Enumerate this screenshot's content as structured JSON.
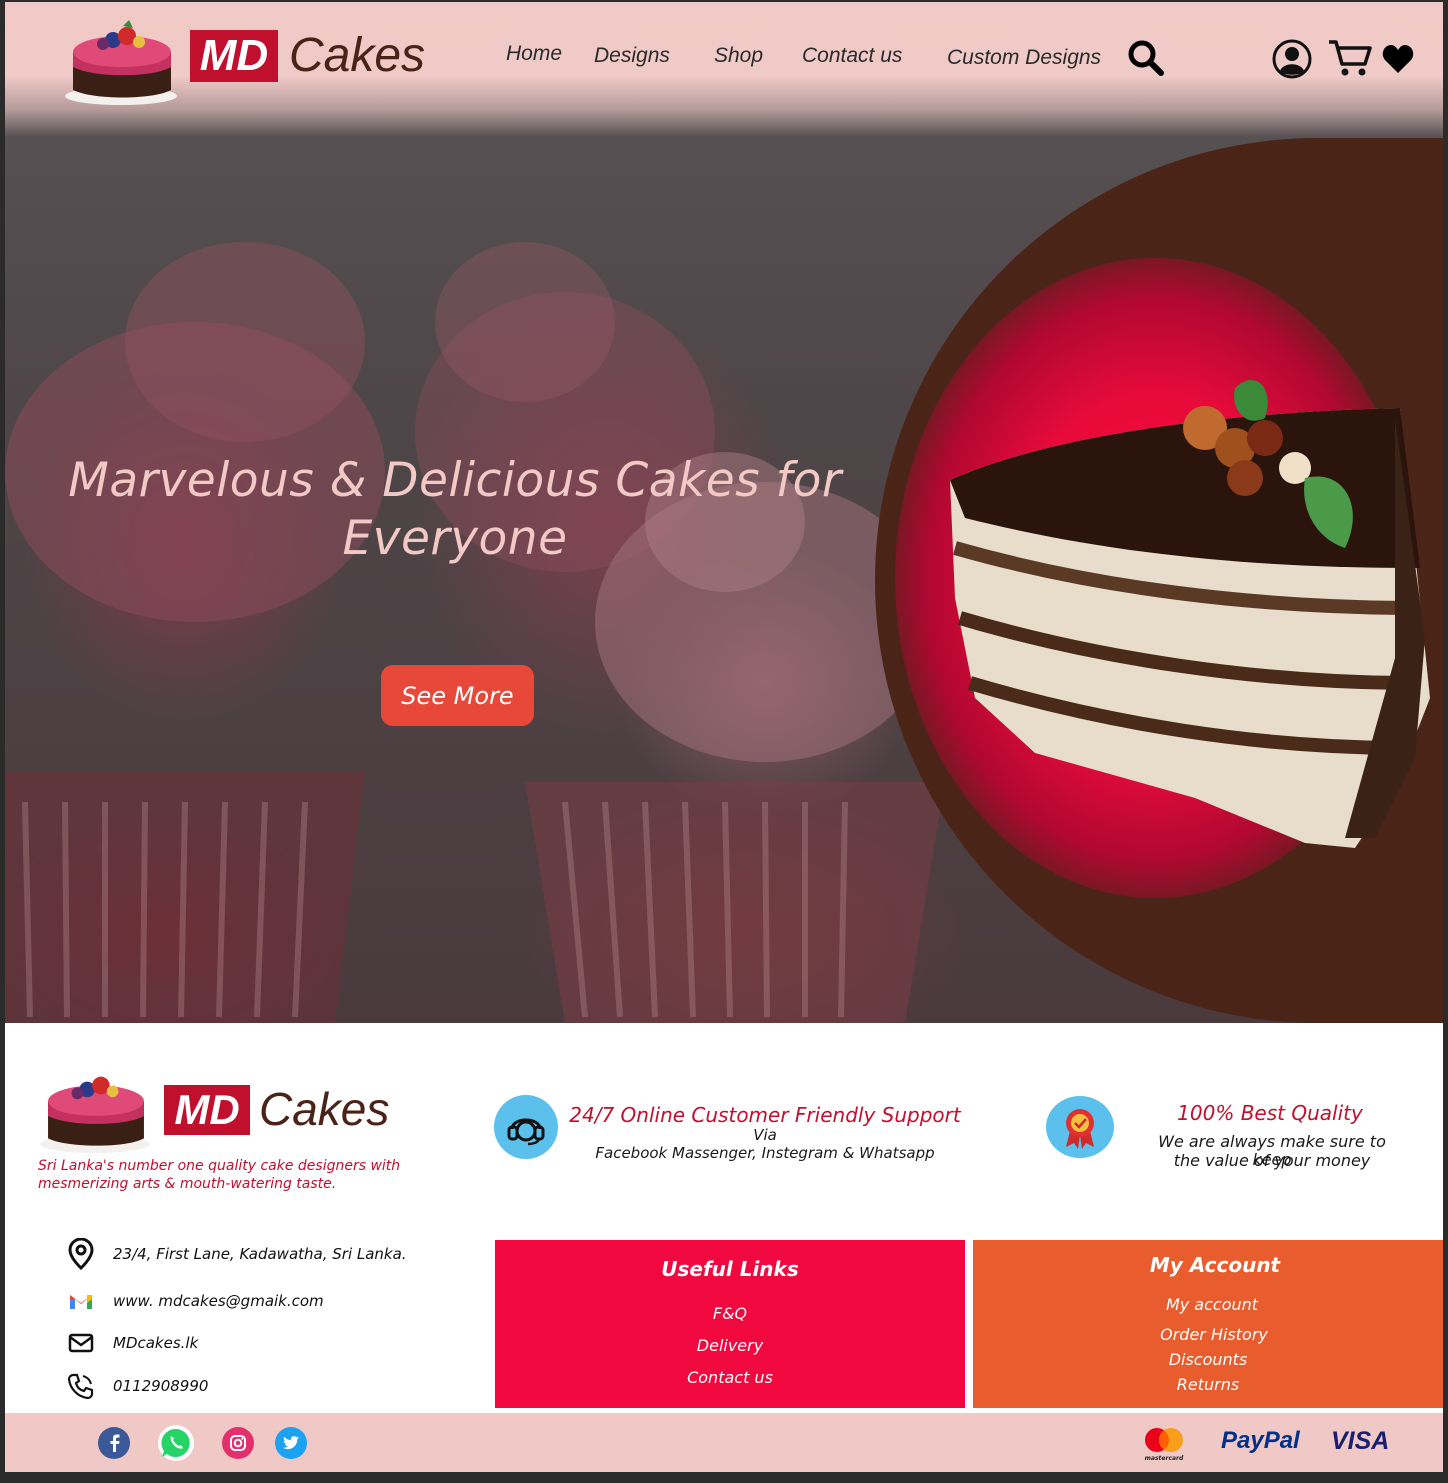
{
  "brand": {
    "md": "MD",
    "cakes": "Cakes"
  },
  "nav": [
    "Home",
    "Designs",
    "Shop",
    "Contact us",
    "Custom Designs"
  ],
  "header_icons": [
    "search-icon",
    "user-icon",
    "cart-icon",
    "heart-icon"
  ],
  "hero": {
    "title_line1": "Marvelous & Delicious Cakes for",
    "title_line2": "Everyone",
    "cta": "See More"
  },
  "footer": {
    "tagline": "Sri Lanka's number one quality cake designers with mesmerizing arts & mouth-watering taste.",
    "support": {
      "title": "24/7  Online Customer Friendly Support",
      "line1": "Via",
      "line2": "Facebook Massenger, Instegram & Whatsapp"
    },
    "quality": {
      "title": "100% Best Quality",
      "line1": "We are always make sure to keep",
      "line2": "the value of your money"
    },
    "contact": {
      "address": "23/4, First Lane, Kadawatha, Sri Lanka.",
      "email": "www. mdcakes@gmaik.com",
      "web": "MDcakes.lk",
      "phone": "0112908990"
    },
    "useful_links": {
      "title": "Useful Links",
      "items": [
        "F&Q",
        "Delivery",
        "Contact us"
      ]
    },
    "my_account": {
      "title": "My Account",
      "items": [
        "My account",
        "Order History",
        "Discounts",
        "Returns"
      ]
    },
    "social": [
      "facebook-icon",
      "whatsapp-icon",
      "instagram-icon",
      "twitter-icon"
    ],
    "payments": {
      "mastercard": "mastercard",
      "paypal": "PayPal",
      "visa": "VISA"
    }
  },
  "colors": {
    "brand_red": "#c0102e",
    "useful_links_bg": "#f0083e",
    "my_account_bg": "#e85c2e",
    "header_bg": "#f1c9c6",
    "cta_bg": "#e7483a"
  }
}
